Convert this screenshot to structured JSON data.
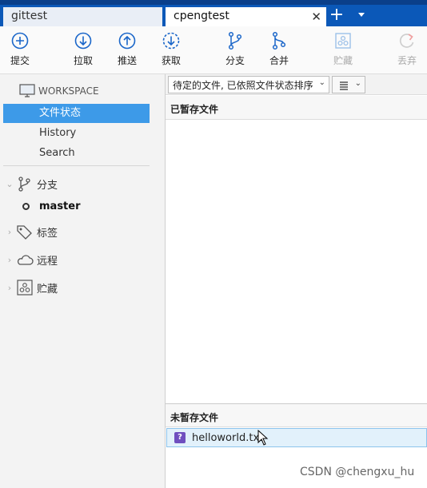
{
  "tabs": [
    {
      "label": "gittest"
    },
    {
      "label": "cpengtest"
    }
  ],
  "tab_close": "✕",
  "tab_add": "+",
  "toolbar": {
    "commit": "提交",
    "pull": "拉取",
    "push": "推送",
    "fetch": "获取",
    "branch": "分支",
    "merge": "合并",
    "stash": "贮藏",
    "discard": "丢弃"
  },
  "sidebar": {
    "workspace": "WORKSPACE",
    "items": [
      {
        "label": "文件状态"
      },
      {
        "label": "History"
      },
      {
        "label": "Search"
      }
    ],
    "groups": {
      "branches": "分支",
      "tags": "标签",
      "remotes": "远程",
      "stashes": "贮藏"
    },
    "current_branch": "master"
  },
  "main": {
    "filter_label": "待定的文件, 已依照文件状态排序",
    "staged_header": "已暂存文件",
    "unstaged_header": "未暂存文件",
    "unstaged_files": [
      {
        "name": "helloworld.txt",
        "status": "?"
      }
    ]
  },
  "watermark": "CSDN @chengxu_hu",
  "colors": {
    "accent": "#0b58b8",
    "selection": "#3d9ae8",
    "file_row_bg": "#e2f1fb",
    "untracked_icon": "#6f4fbf"
  }
}
